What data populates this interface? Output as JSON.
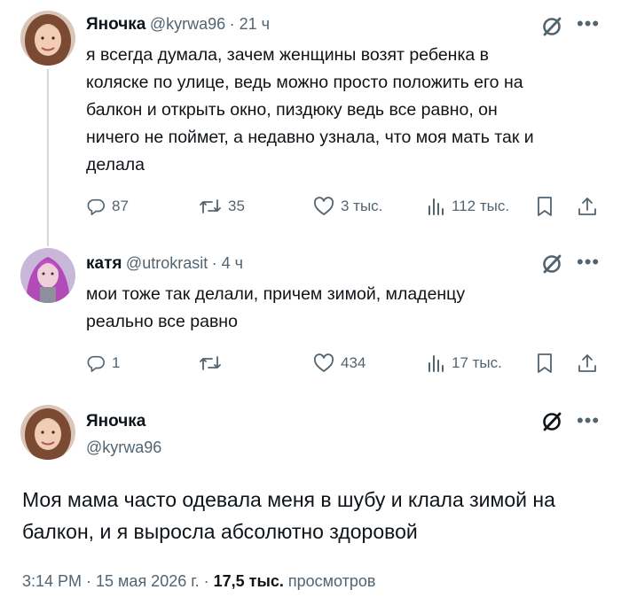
{
  "tweets": [
    {
      "display_name": "Яночка",
      "handle": "@kyrwa96",
      "time": "· 21 ч",
      "text": "я всегда думала, зачем женщины возят ребенка в\nколяске по улице, ведь можно просто положить его на\nбалкон и открыть окно, пиздюку ведь все равно, он\nничего не поймет, а недавно узнала, что моя мать так и\nделала",
      "replies": "87",
      "reposts": "35",
      "likes": "3 тыс.",
      "views": "112 тыс."
    },
    {
      "display_name": "катя",
      "handle": "@utrokrasit",
      "time": "· 4 ч",
      "text": "мои тоже так делали, причем зимой, младенцу\nреально все равно",
      "replies": "1",
      "reposts": "",
      "likes": "434",
      "views": "17 тыс."
    }
  ],
  "main_tweet": {
    "display_name": "Яночка",
    "handle": "@kyrwa96",
    "text": "Моя мама часто одевала меня в шубу и клала зимой на\nбалкон, и я выросла абсолютно здоровой",
    "timestamp": "3:14 PM · 15 мая 2026 г. · ",
    "views_count": "17,5 тыс.",
    "views_label": " просмотров"
  },
  "colors": {
    "text": "#0f1419",
    "secondary": "#536471",
    "line": "#cfd9de"
  },
  "icons": [
    "reply-icon",
    "repost-icon",
    "like-icon",
    "views-icon",
    "bookmark-icon",
    "share-icon",
    "grok-icon",
    "more-icon"
  ]
}
